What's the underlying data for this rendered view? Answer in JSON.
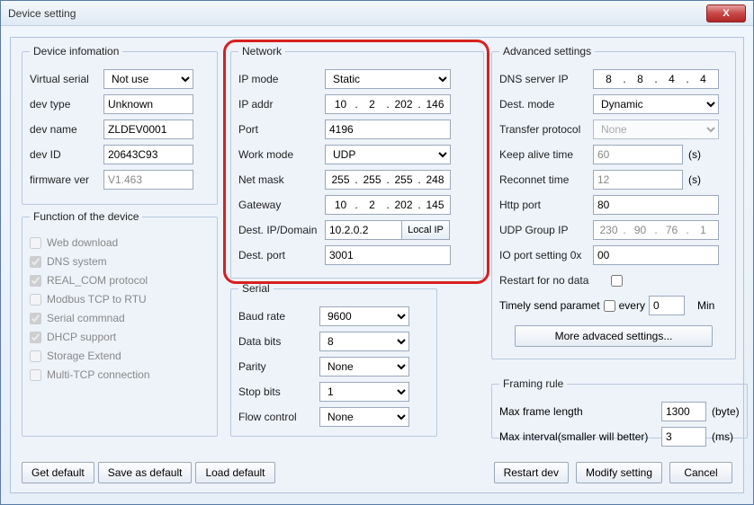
{
  "window": {
    "title": "Device setting",
    "close_x": "X"
  },
  "devinfo": {
    "legend": "Device infomation",
    "virtual_serial_label": "Virtual serial",
    "virtual_serial": "Not use",
    "dev_type_label": "dev type",
    "dev_type": "Unknown",
    "dev_name_label": "dev name",
    "dev_name": "ZLDEV0001",
    "dev_id_label": "dev ID",
    "dev_id": "20643C93",
    "firmware_label": "firmware ver",
    "firmware": "V1.463"
  },
  "func": {
    "legend": "Function of the device",
    "web_download": "Web download",
    "dns_system": "DNS system",
    "real_com": "REAL_COM protocol",
    "modbus": "Modbus TCP to RTU",
    "serial_cmd": "Serial commnad",
    "dhcp": "DHCP support",
    "storage": "Storage Extend",
    "multitcp": "Multi-TCP connection"
  },
  "net": {
    "legend": "Network",
    "ip_mode_label": "IP mode",
    "ip_mode": "Static",
    "ip_addr_label": "IP addr",
    "ip_addr": {
      "a": "10",
      "b": "2",
      "c": "202",
      "d": "146"
    },
    "port_label": "Port",
    "port": "4196",
    "work_mode_label": "Work mode",
    "work_mode": "UDP",
    "netmask_label": "Net mask",
    "netmask": {
      "a": "255",
      "b": "255",
      "c": "255",
      "d": "248"
    },
    "gateway_label": "Gateway",
    "gateway": {
      "a": "10",
      "b": "2",
      "c": "202",
      "d": "145"
    },
    "dest_ip_label": "Dest. IP/Domain",
    "dest_ip": "10.2.0.2",
    "local_ip_btn": "Local IP",
    "dest_port_label": "Dest. port",
    "dest_port": "3001"
  },
  "serial": {
    "legend": "Serial",
    "baud_label": "Baud rate",
    "baud": "9600",
    "databits_label": "Data bits",
    "databits": "8",
    "parity_label": "Parity",
    "parity": "None",
    "stopbits_label": "Stop bits",
    "stopbits": "1",
    "flow_label": "Flow control",
    "flow": "None"
  },
  "adv": {
    "legend": "Advanced settings",
    "dns_label": "DNS server IP",
    "dns_ip": {
      "a": "8",
      "b": "8",
      "c": "4",
      "d": "4"
    },
    "destmode_label": "Dest. mode",
    "destmode": "Dynamic",
    "transfer_label": "Transfer protocol",
    "transfer": "None",
    "keepalive_label": "Keep alive time",
    "keepalive": "60",
    "reconnect_label": "Reconnet time",
    "reconnect": "12",
    "sec_unit": "(s)",
    "http_label": "Http port",
    "http": "80",
    "udpgroup_label": "UDP Group IP",
    "udpgroup": {
      "a": "230",
      "b": "90",
      "c": "76",
      "d": "1"
    },
    "ioport_label": "IO port setting 0x",
    "ioport": "00",
    "restart_label": "Restart for no data",
    "timely_label": "Timely send paramet",
    "every_label": "every",
    "timely_value": "0",
    "min_label": "Min",
    "more_btn": "More advaced settings..."
  },
  "framing": {
    "legend": "Framing rule",
    "maxframe_label": "Max frame length",
    "maxframe": "1300",
    "byte_unit": "(byte)",
    "maxinterval_label": "Max interval(smaller will better)",
    "maxinterval": "3",
    "ms_unit": "(ms)"
  },
  "buttons": {
    "get_default": "Get default",
    "save_default": "Save as default",
    "load_default": "Load default",
    "restart": "Restart dev",
    "modify": "Modify setting",
    "cancel": "Cancel"
  }
}
